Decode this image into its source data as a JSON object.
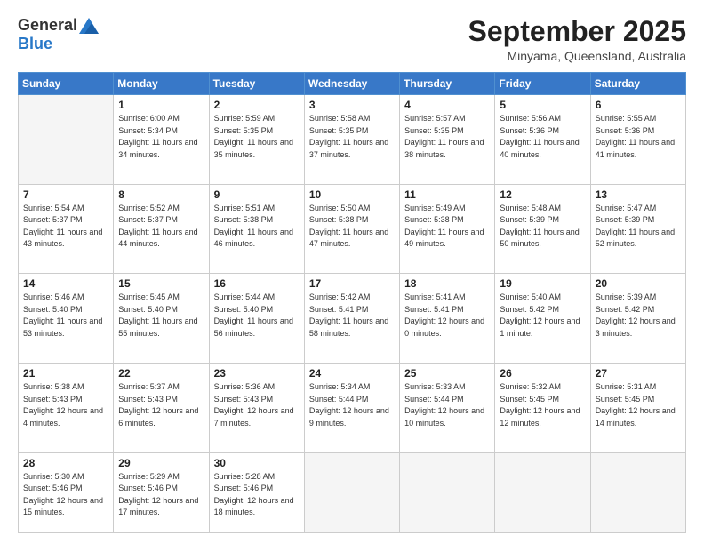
{
  "header": {
    "logo_general": "General",
    "logo_blue": "Blue",
    "month_title": "September 2025",
    "location": "Minyama, Queensland, Australia"
  },
  "days_of_week": [
    "Sunday",
    "Monday",
    "Tuesday",
    "Wednesday",
    "Thursday",
    "Friday",
    "Saturday"
  ],
  "weeks": [
    [
      {
        "day": "",
        "sunrise": "",
        "sunset": "",
        "daylight": ""
      },
      {
        "day": "1",
        "sunrise": "6:00 AM",
        "sunset": "5:34 PM",
        "daylight": "11 hours and 34 minutes."
      },
      {
        "day": "2",
        "sunrise": "5:59 AM",
        "sunset": "5:35 PM",
        "daylight": "11 hours and 35 minutes."
      },
      {
        "day": "3",
        "sunrise": "5:58 AM",
        "sunset": "5:35 PM",
        "daylight": "11 hours and 37 minutes."
      },
      {
        "day": "4",
        "sunrise": "5:57 AM",
        "sunset": "5:35 PM",
        "daylight": "11 hours and 38 minutes."
      },
      {
        "day": "5",
        "sunrise": "5:56 AM",
        "sunset": "5:36 PM",
        "daylight": "11 hours and 40 minutes."
      },
      {
        "day": "6",
        "sunrise": "5:55 AM",
        "sunset": "5:36 PM",
        "daylight": "11 hours and 41 minutes."
      }
    ],
    [
      {
        "day": "7",
        "sunrise": "5:54 AM",
        "sunset": "5:37 PM",
        "daylight": "11 hours and 43 minutes."
      },
      {
        "day": "8",
        "sunrise": "5:52 AM",
        "sunset": "5:37 PM",
        "daylight": "11 hours and 44 minutes."
      },
      {
        "day": "9",
        "sunrise": "5:51 AM",
        "sunset": "5:38 PM",
        "daylight": "11 hours and 46 minutes."
      },
      {
        "day": "10",
        "sunrise": "5:50 AM",
        "sunset": "5:38 PM",
        "daylight": "11 hours and 47 minutes."
      },
      {
        "day": "11",
        "sunrise": "5:49 AM",
        "sunset": "5:38 PM",
        "daylight": "11 hours and 49 minutes."
      },
      {
        "day": "12",
        "sunrise": "5:48 AM",
        "sunset": "5:39 PM",
        "daylight": "11 hours and 50 minutes."
      },
      {
        "day": "13",
        "sunrise": "5:47 AM",
        "sunset": "5:39 PM",
        "daylight": "11 hours and 52 minutes."
      }
    ],
    [
      {
        "day": "14",
        "sunrise": "5:46 AM",
        "sunset": "5:40 PM",
        "daylight": "11 hours and 53 minutes."
      },
      {
        "day": "15",
        "sunrise": "5:45 AM",
        "sunset": "5:40 PM",
        "daylight": "11 hours and 55 minutes."
      },
      {
        "day": "16",
        "sunrise": "5:44 AM",
        "sunset": "5:40 PM",
        "daylight": "11 hours and 56 minutes."
      },
      {
        "day": "17",
        "sunrise": "5:42 AM",
        "sunset": "5:41 PM",
        "daylight": "11 hours and 58 minutes."
      },
      {
        "day": "18",
        "sunrise": "5:41 AM",
        "sunset": "5:41 PM",
        "daylight": "12 hours and 0 minutes."
      },
      {
        "day": "19",
        "sunrise": "5:40 AM",
        "sunset": "5:42 PM",
        "daylight": "12 hours and 1 minute."
      },
      {
        "day": "20",
        "sunrise": "5:39 AM",
        "sunset": "5:42 PM",
        "daylight": "12 hours and 3 minutes."
      }
    ],
    [
      {
        "day": "21",
        "sunrise": "5:38 AM",
        "sunset": "5:43 PM",
        "daylight": "12 hours and 4 minutes."
      },
      {
        "day": "22",
        "sunrise": "5:37 AM",
        "sunset": "5:43 PM",
        "daylight": "12 hours and 6 minutes."
      },
      {
        "day": "23",
        "sunrise": "5:36 AM",
        "sunset": "5:43 PM",
        "daylight": "12 hours and 7 minutes."
      },
      {
        "day": "24",
        "sunrise": "5:34 AM",
        "sunset": "5:44 PM",
        "daylight": "12 hours and 9 minutes."
      },
      {
        "day": "25",
        "sunrise": "5:33 AM",
        "sunset": "5:44 PM",
        "daylight": "12 hours and 10 minutes."
      },
      {
        "day": "26",
        "sunrise": "5:32 AM",
        "sunset": "5:45 PM",
        "daylight": "12 hours and 12 minutes."
      },
      {
        "day": "27",
        "sunrise": "5:31 AM",
        "sunset": "5:45 PM",
        "daylight": "12 hours and 14 minutes."
      }
    ],
    [
      {
        "day": "28",
        "sunrise": "5:30 AM",
        "sunset": "5:46 PM",
        "daylight": "12 hours and 15 minutes."
      },
      {
        "day": "29",
        "sunrise": "5:29 AM",
        "sunset": "5:46 PM",
        "daylight": "12 hours and 17 minutes."
      },
      {
        "day": "30",
        "sunrise": "5:28 AM",
        "sunset": "5:46 PM",
        "daylight": "12 hours and 18 minutes."
      },
      {
        "day": "",
        "sunrise": "",
        "sunset": "",
        "daylight": ""
      },
      {
        "day": "",
        "sunrise": "",
        "sunset": "",
        "daylight": ""
      },
      {
        "day": "",
        "sunrise": "",
        "sunset": "",
        "daylight": ""
      },
      {
        "day": "",
        "sunrise": "",
        "sunset": "",
        "daylight": ""
      }
    ]
  ],
  "labels": {
    "sunrise_prefix": "Sunrise: ",
    "sunset_prefix": "Sunset: ",
    "daylight_prefix": "Daylight: "
  }
}
